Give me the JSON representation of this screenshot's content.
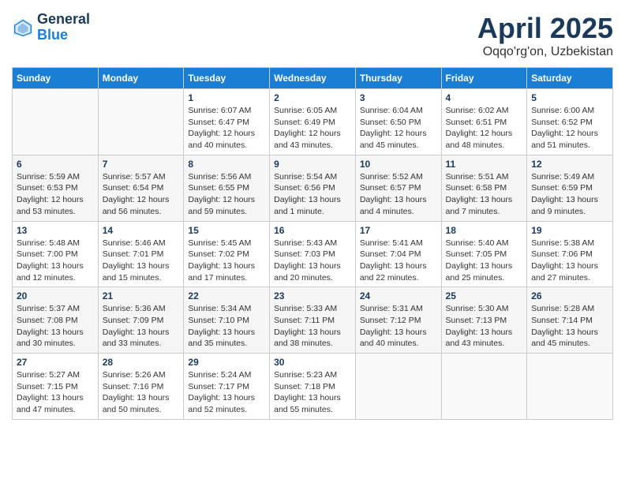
{
  "header": {
    "logo_general": "General",
    "logo_blue": "Blue",
    "month": "April 2025",
    "location": "Oqqo'rg'on, Uzbekistan"
  },
  "weekdays": [
    "Sunday",
    "Monday",
    "Tuesday",
    "Wednesday",
    "Thursday",
    "Friday",
    "Saturday"
  ],
  "weeks": [
    [
      {
        "day": null
      },
      {
        "day": null
      },
      {
        "day": "1",
        "sunrise": "Sunrise: 6:07 AM",
        "sunset": "Sunset: 6:47 PM",
        "daylight": "Daylight: 12 hours and 40 minutes."
      },
      {
        "day": "2",
        "sunrise": "Sunrise: 6:05 AM",
        "sunset": "Sunset: 6:49 PM",
        "daylight": "Daylight: 12 hours and 43 minutes."
      },
      {
        "day": "3",
        "sunrise": "Sunrise: 6:04 AM",
        "sunset": "Sunset: 6:50 PM",
        "daylight": "Daylight: 12 hours and 45 minutes."
      },
      {
        "day": "4",
        "sunrise": "Sunrise: 6:02 AM",
        "sunset": "Sunset: 6:51 PM",
        "daylight": "Daylight: 12 hours and 48 minutes."
      },
      {
        "day": "5",
        "sunrise": "Sunrise: 6:00 AM",
        "sunset": "Sunset: 6:52 PM",
        "daylight": "Daylight: 12 hours and 51 minutes."
      }
    ],
    [
      {
        "day": "6",
        "sunrise": "Sunrise: 5:59 AM",
        "sunset": "Sunset: 6:53 PM",
        "daylight": "Daylight: 12 hours and 53 minutes."
      },
      {
        "day": "7",
        "sunrise": "Sunrise: 5:57 AM",
        "sunset": "Sunset: 6:54 PM",
        "daylight": "Daylight: 12 hours and 56 minutes."
      },
      {
        "day": "8",
        "sunrise": "Sunrise: 5:56 AM",
        "sunset": "Sunset: 6:55 PM",
        "daylight": "Daylight: 12 hours and 59 minutes."
      },
      {
        "day": "9",
        "sunrise": "Sunrise: 5:54 AM",
        "sunset": "Sunset: 6:56 PM",
        "daylight": "Daylight: 13 hours and 1 minute."
      },
      {
        "day": "10",
        "sunrise": "Sunrise: 5:52 AM",
        "sunset": "Sunset: 6:57 PM",
        "daylight": "Daylight: 13 hours and 4 minutes."
      },
      {
        "day": "11",
        "sunrise": "Sunrise: 5:51 AM",
        "sunset": "Sunset: 6:58 PM",
        "daylight": "Daylight: 13 hours and 7 minutes."
      },
      {
        "day": "12",
        "sunrise": "Sunrise: 5:49 AM",
        "sunset": "Sunset: 6:59 PM",
        "daylight": "Daylight: 13 hours and 9 minutes."
      }
    ],
    [
      {
        "day": "13",
        "sunrise": "Sunrise: 5:48 AM",
        "sunset": "Sunset: 7:00 PM",
        "daylight": "Daylight: 13 hours and 12 minutes."
      },
      {
        "day": "14",
        "sunrise": "Sunrise: 5:46 AM",
        "sunset": "Sunset: 7:01 PM",
        "daylight": "Daylight: 13 hours and 15 minutes."
      },
      {
        "day": "15",
        "sunrise": "Sunrise: 5:45 AM",
        "sunset": "Sunset: 7:02 PM",
        "daylight": "Daylight: 13 hours and 17 minutes."
      },
      {
        "day": "16",
        "sunrise": "Sunrise: 5:43 AM",
        "sunset": "Sunset: 7:03 PM",
        "daylight": "Daylight: 13 hours and 20 minutes."
      },
      {
        "day": "17",
        "sunrise": "Sunrise: 5:41 AM",
        "sunset": "Sunset: 7:04 PM",
        "daylight": "Daylight: 13 hours and 22 minutes."
      },
      {
        "day": "18",
        "sunrise": "Sunrise: 5:40 AM",
        "sunset": "Sunset: 7:05 PM",
        "daylight": "Daylight: 13 hours and 25 minutes."
      },
      {
        "day": "19",
        "sunrise": "Sunrise: 5:38 AM",
        "sunset": "Sunset: 7:06 PM",
        "daylight": "Daylight: 13 hours and 27 minutes."
      }
    ],
    [
      {
        "day": "20",
        "sunrise": "Sunrise: 5:37 AM",
        "sunset": "Sunset: 7:08 PM",
        "daylight": "Daylight: 13 hours and 30 minutes."
      },
      {
        "day": "21",
        "sunrise": "Sunrise: 5:36 AM",
        "sunset": "Sunset: 7:09 PM",
        "daylight": "Daylight: 13 hours and 33 minutes."
      },
      {
        "day": "22",
        "sunrise": "Sunrise: 5:34 AM",
        "sunset": "Sunset: 7:10 PM",
        "daylight": "Daylight: 13 hours and 35 minutes."
      },
      {
        "day": "23",
        "sunrise": "Sunrise: 5:33 AM",
        "sunset": "Sunset: 7:11 PM",
        "daylight": "Daylight: 13 hours and 38 minutes."
      },
      {
        "day": "24",
        "sunrise": "Sunrise: 5:31 AM",
        "sunset": "Sunset: 7:12 PM",
        "daylight": "Daylight: 13 hours and 40 minutes."
      },
      {
        "day": "25",
        "sunrise": "Sunrise: 5:30 AM",
        "sunset": "Sunset: 7:13 PM",
        "daylight": "Daylight: 13 hours and 43 minutes."
      },
      {
        "day": "26",
        "sunrise": "Sunrise: 5:28 AM",
        "sunset": "Sunset: 7:14 PM",
        "daylight": "Daylight: 13 hours and 45 minutes."
      }
    ],
    [
      {
        "day": "27",
        "sunrise": "Sunrise: 5:27 AM",
        "sunset": "Sunset: 7:15 PM",
        "daylight": "Daylight: 13 hours and 47 minutes."
      },
      {
        "day": "28",
        "sunrise": "Sunrise: 5:26 AM",
        "sunset": "Sunset: 7:16 PM",
        "daylight": "Daylight: 13 hours and 50 minutes."
      },
      {
        "day": "29",
        "sunrise": "Sunrise: 5:24 AM",
        "sunset": "Sunset: 7:17 PM",
        "daylight": "Daylight: 13 hours and 52 minutes."
      },
      {
        "day": "30",
        "sunrise": "Sunrise: 5:23 AM",
        "sunset": "Sunset: 7:18 PM",
        "daylight": "Daylight: 13 hours and 55 minutes."
      },
      {
        "day": null
      },
      {
        "day": null
      },
      {
        "day": null
      }
    ]
  ]
}
